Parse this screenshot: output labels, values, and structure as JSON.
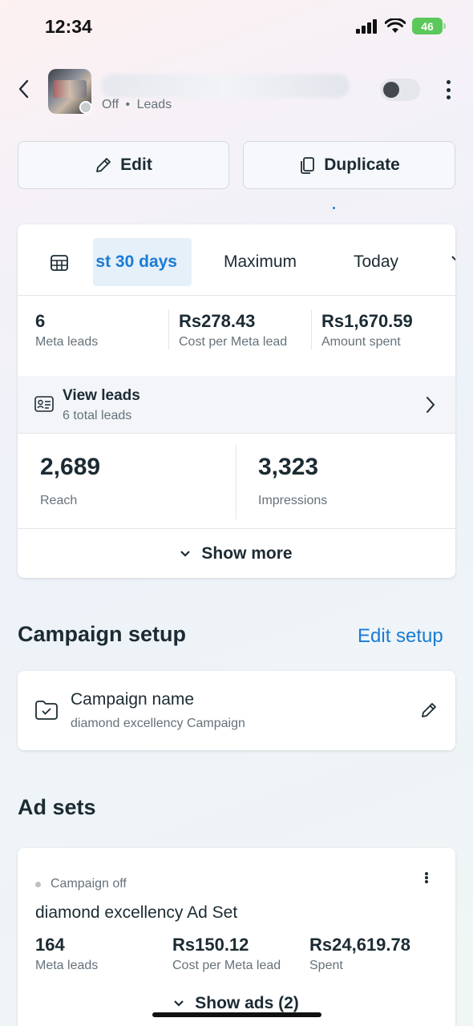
{
  "status_bar": {
    "time": "12:34",
    "battery": "46"
  },
  "header": {
    "status": "Off",
    "separator": "•",
    "objective": "Leads"
  },
  "actions": {
    "edit_label": "Edit",
    "duplicate_label": "Duplicate"
  },
  "date_tabs": {
    "selected": "st 30 days",
    "tabs": [
      "Maximum",
      "Today"
    ]
  },
  "metrics": [
    {
      "value": "6",
      "label": "Meta leads"
    },
    {
      "value": "Rs278.43",
      "label": "Cost per Meta lead"
    },
    {
      "value": "Rs1,670.59",
      "label": "Amount spent"
    }
  ],
  "view_leads": {
    "title": "View leads",
    "subtitle": "6 total leads"
  },
  "reach": {
    "value": "2,689",
    "label": "Reach"
  },
  "impressions": {
    "value": "3,323",
    "label": "Impressions"
  },
  "show_more_label": "Show more",
  "campaign_setup": {
    "title": "Campaign setup",
    "edit_link": "Edit setup",
    "name_label": "Campaign name",
    "name_value": "diamond excellency Campaign"
  },
  "ad_sets": {
    "title": "Ad sets",
    "items": [
      {
        "status": "Campaign off",
        "name": "diamond excellency Ad Set",
        "metrics": [
          {
            "value": "164",
            "label": "Meta leads"
          },
          {
            "value": "Rs150.12",
            "label": "Cost per Meta lead"
          },
          {
            "value": "Rs24,619.78",
            "label": "Spent"
          }
        ],
        "show_ads_label": "Show ads (2)"
      }
    ]
  }
}
